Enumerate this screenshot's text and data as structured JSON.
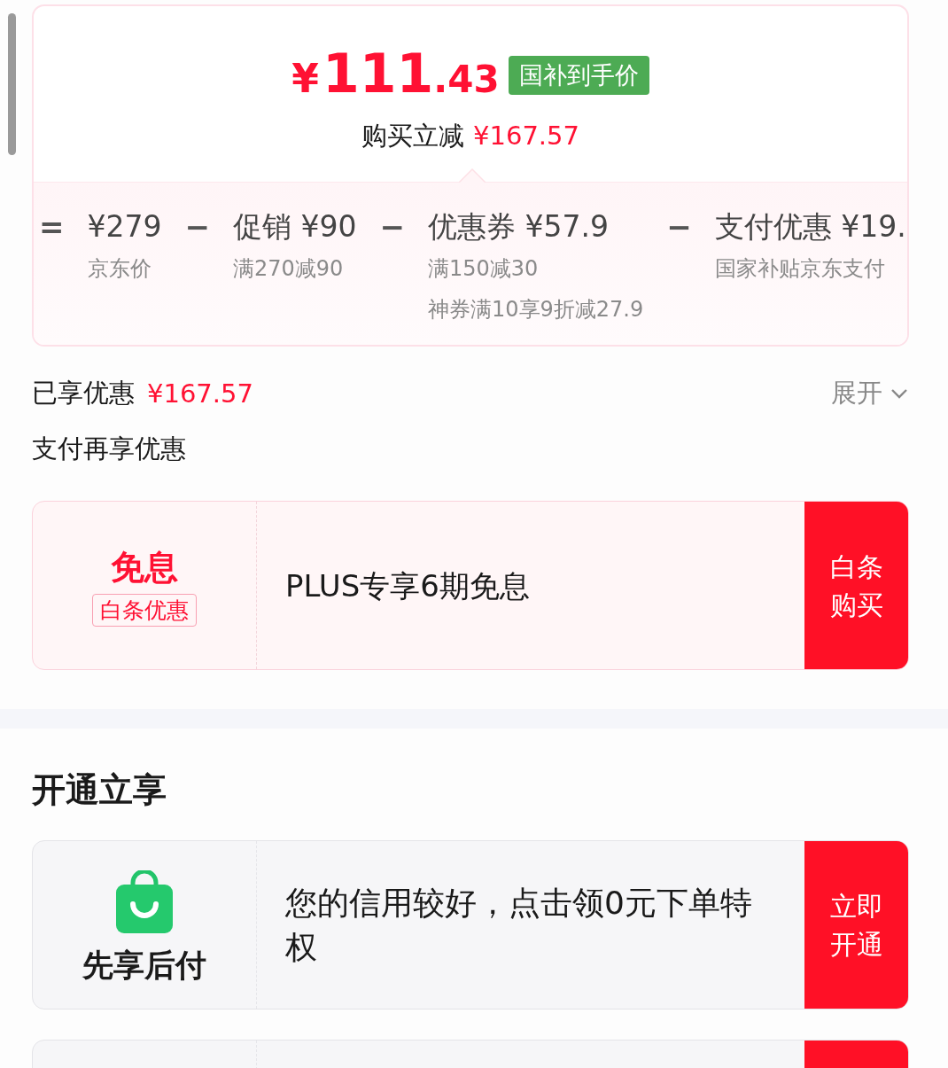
{
  "price": {
    "currency": "¥",
    "integer": "111",
    "decimal": ".43",
    "badge": "国补到手价"
  },
  "saving": {
    "label": "购买立减",
    "amount": "¥167.57"
  },
  "breakdown": [
    {
      "operator": "=",
      "title": "¥279",
      "notes": [
        "京东价"
      ]
    },
    {
      "operator": "−",
      "title": "促销 ¥90",
      "notes": [
        "满270减90"
      ]
    },
    {
      "operator": "−",
      "title": "优惠券 ¥57.9",
      "notes": [
        "满150减30",
        "神券满10享9折减27.9"
      ]
    },
    {
      "operator": "−",
      "title": "支付优惠 ¥19.",
      "notes": [
        "国家补贴京东支付"
      ]
    }
  ],
  "discount_summary": {
    "label": "已享优惠",
    "amount": "¥167.57",
    "toggle": "展开"
  },
  "pay_section": {
    "title": "支付再享优惠",
    "offers": [
      {
        "kind": "tag",
        "tag_title": "免息",
        "tag_badge": "白条优惠",
        "text": "PLUS专享6期免息",
        "button": "白条购买"
      }
    ]
  },
  "open_section": {
    "title": "开通立享",
    "offers": [
      {
        "kind": "icon",
        "label": "先享后付",
        "text": "您的信用较好，点击领0元下单特权",
        "button": "立即开通"
      }
    ]
  }
}
